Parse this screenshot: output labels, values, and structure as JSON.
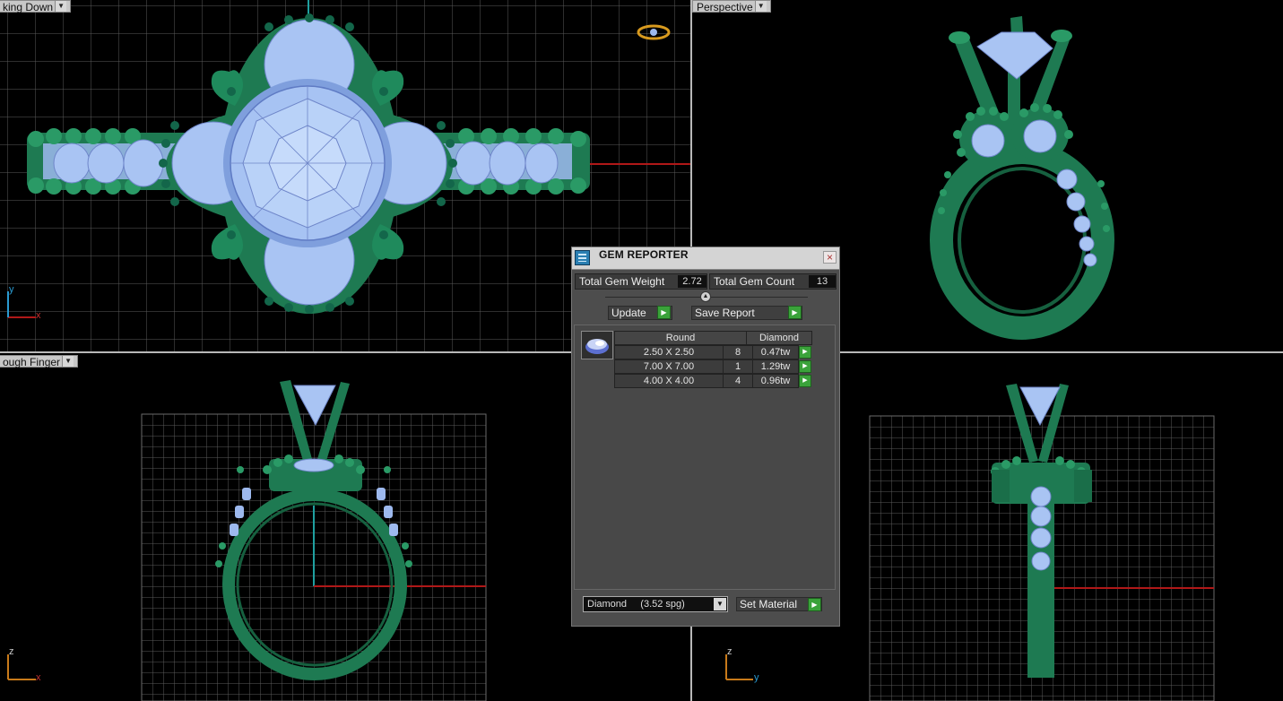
{
  "viewports": {
    "top_left": {
      "label": "king Down"
    },
    "top_right": {
      "label": "Perspective"
    },
    "bottom_left": {
      "label": "ough Finger"
    },
    "bottom_right": {
      "label": ""
    }
  },
  "axes": {
    "top_left": {
      "horizontal": "x",
      "vertical": "y"
    },
    "bottom_left": {
      "horizontal": "x",
      "vertical": "z"
    },
    "bottom_right": {
      "horizontal": "y",
      "vertical": "z"
    }
  },
  "panel": {
    "title": "GEM REPORTER",
    "close_label": "×",
    "total_weight_label": "Total Gem Weight",
    "total_weight_value": "2.72",
    "total_count_label": "Total Gem Count",
    "total_count_value": "13",
    "update_label": "Update",
    "save_report_label": "Save Report",
    "table": {
      "shape_header": "Round",
      "material_header": "Diamond",
      "rows": [
        {
          "size": "2.50 X 2.50",
          "count": "8",
          "weight": "0.47tw"
        },
        {
          "size": "7.00 X 7.00",
          "count": "1",
          "weight": "1.29tw"
        },
        {
          "size": "4.00 X 4.00",
          "count": "4",
          "weight": "0.96tw"
        }
      ]
    },
    "material_select": "Diamond     (3.52 spg)",
    "set_material_label": "Set Material"
  },
  "colors": {
    "metal": "#1e7a52",
    "gem": "#9db9ee",
    "grid": "#5a5a5a",
    "background": "#000000",
    "accent_button": "#3aa23a"
  }
}
